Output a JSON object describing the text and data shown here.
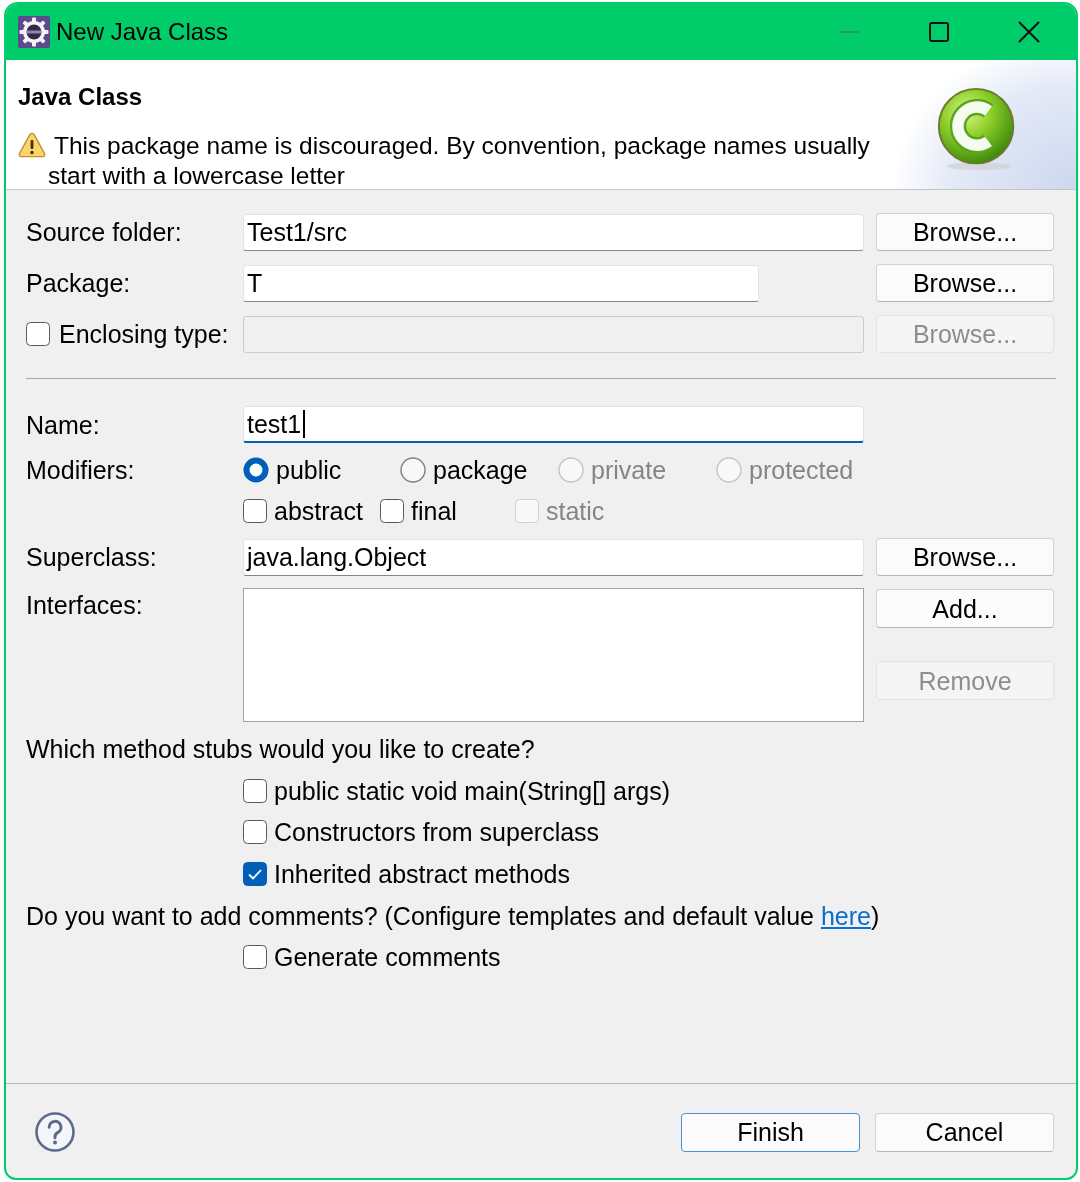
{
  "window": {
    "title": "New Java Class",
    "controls": [
      {
        "kind": "minimize",
        "disabled": true
      },
      {
        "kind": "maximize",
        "disabled": false
      },
      {
        "kind": "close",
        "disabled": false
      }
    ]
  },
  "header": {
    "title": "Java Class",
    "message": "This package name is discouraged. By convention, package names usually start with a lowercase letter"
  },
  "source_folder": {
    "label": "Source folder:",
    "value": "Test1/src",
    "button": {
      "label": "Browse...",
      "disabled": false
    }
  },
  "package": {
    "label": "Package:",
    "value": "T",
    "button": {
      "label": "Browse...",
      "disabled": false
    }
  },
  "enclosing_type": {
    "label": "Enclosing type:",
    "checked": false,
    "field": {
      "disabled": true
    },
    "button": {
      "label": "Browse...",
      "disabled": true
    }
  },
  "name": {
    "label": "Name:",
    "value": "test1",
    "focused": true
  },
  "modifiers": {
    "label": "Modifiers:",
    "visibility": [
      {
        "label": "public",
        "selected": true,
        "disabled": false
      },
      {
        "label": "package",
        "selected": false,
        "disabled": false
      },
      {
        "label": "private",
        "selected": false,
        "disabled": true
      },
      {
        "label": "protected",
        "selected": false,
        "disabled": true
      }
    ],
    "flags": [
      {
        "label": "abstract",
        "checked": false,
        "disabled": false
      },
      {
        "label": "final",
        "checked": false,
        "disabled": false
      },
      {
        "label": "static",
        "checked": false,
        "disabled": true
      }
    ]
  },
  "superclass": {
    "label": "Superclass:",
    "value": "java.lang.Object",
    "button": {
      "label": "Browse...",
      "disabled": false
    }
  },
  "interfaces": {
    "label": "Interfaces:",
    "buttons": [
      {
        "label": "Add...",
        "disabled": false
      },
      {
        "label": "Remove",
        "disabled": true
      }
    ]
  },
  "method_stubs": {
    "question": "Which method stubs would you like to create?",
    "options": [
      {
        "label": "public static void main(String[] args)",
        "checked": false
      },
      {
        "label": "Constructors from superclass",
        "checked": false
      },
      {
        "label": "Inherited abstract methods",
        "checked": true
      }
    ]
  },
  "comments": {
    "question": "Do you want to add comments? (Configure templates and default value ",
    "link": "here",
    "question_end": ")",
    "options": [
      {
        "label": "Generate comments",
        "checked": false
      }
    ]
  },
  "footer": {
    "buttons": [
      {
        "label": "Finish",
        "default": true
      },
      {
        "label": "Cancel",
        "default": false
      }
    ]
  }
}
